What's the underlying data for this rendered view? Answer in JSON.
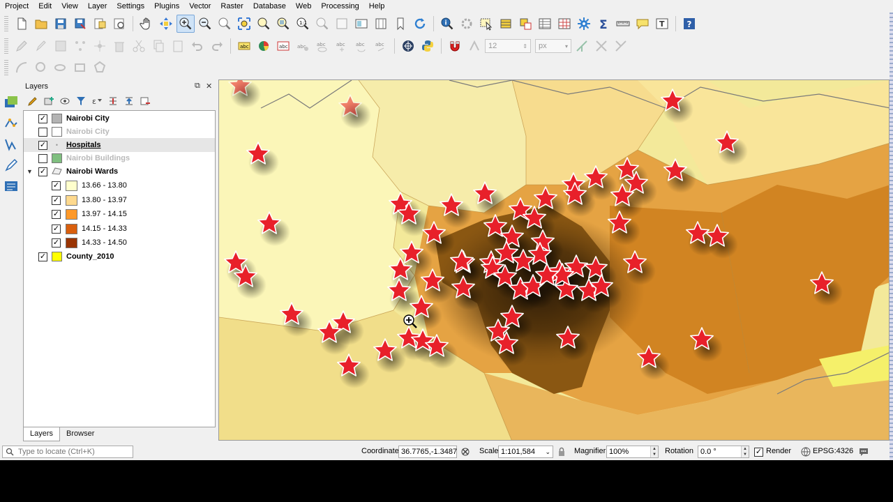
{
  "menu": [
    "Project",
    "Edit",
    "View",
    "Layer",
    "Settings",
    "Plugins",
    "Vector",
    "Raster",
    "Database",
    "Web",
    "Processing",
    "Help"
  ],
  "toolbar": {
    "font_size_value": "12",
    "font_unit": "px"
  },
  "layers_panel": {
    "title": "Layers",
    "float_glyph": "⧉",
    "close_glyph": "✕",
    "layers": [
      {
        "name": "Nairobi City",
        "checked": true,
        "color": "#b3b3b3",
        "faded": false
      },
      {
        "name": "Nairobi City",
        "checked": false,
        "color": "#ffffff",
        "faded": true
      },
      {
        "name": "Hospitals",
        "checked": true,
        "faded": false,
        "selected": true
      },
      {
        "name": "Nairobi Buildings",
        "checked": false,
        "color": "#7fbf7f",
        "faded": true
      },
      {
        "name": "Nairobi Wards",
        "checked": true,
        "expanded": true,
        "faded": false
      },
      {
        "name": "County_2010",
        "checked": true,
        "color": "#ffff00",
        "faded": false
      }
    ],
    "legend": [
      {
        "label": "13.66 - 13.80",
        "color": "#ffffcc"
      },
      {
        "label": "13.80 - 13.97",
        "color": "#fed98e"
      },
      {
        "label": "13.97 - 14.15",
        "color": "#fe9929"
      },
      {
        "label": "14.15 - 14.33",
        "color": "#d95f0e"
      },
      {
        "label": "14.33 - 14.50",
        "color": "#993404"
      }
    ],
    "tabs": [
      "Layers",
      "Browser"
    ]
  },
  "statusbar": {
    "locator_placeholder": "Type to locate (Ctrl+K)",
    "coordinate_label": "Coordinate",
    "coordinate_value": "36.7765,-1.3487",
    "scale_label": "Scale",
    "scale_value": "1:101,584",
    "magnifier_label": "Magnifier",
    "magnifier_value": "100%",
    "rotation_label": "Rotation",
    "rotation_value": "0.0 °",
    "render_label": "Render",
    "render_checked": true,
    "crs": "EPSG:4326"
  },
  "map": {
    "marker_color": "#e8202a",
    "background_color": "#f6f29a"
  }
}
